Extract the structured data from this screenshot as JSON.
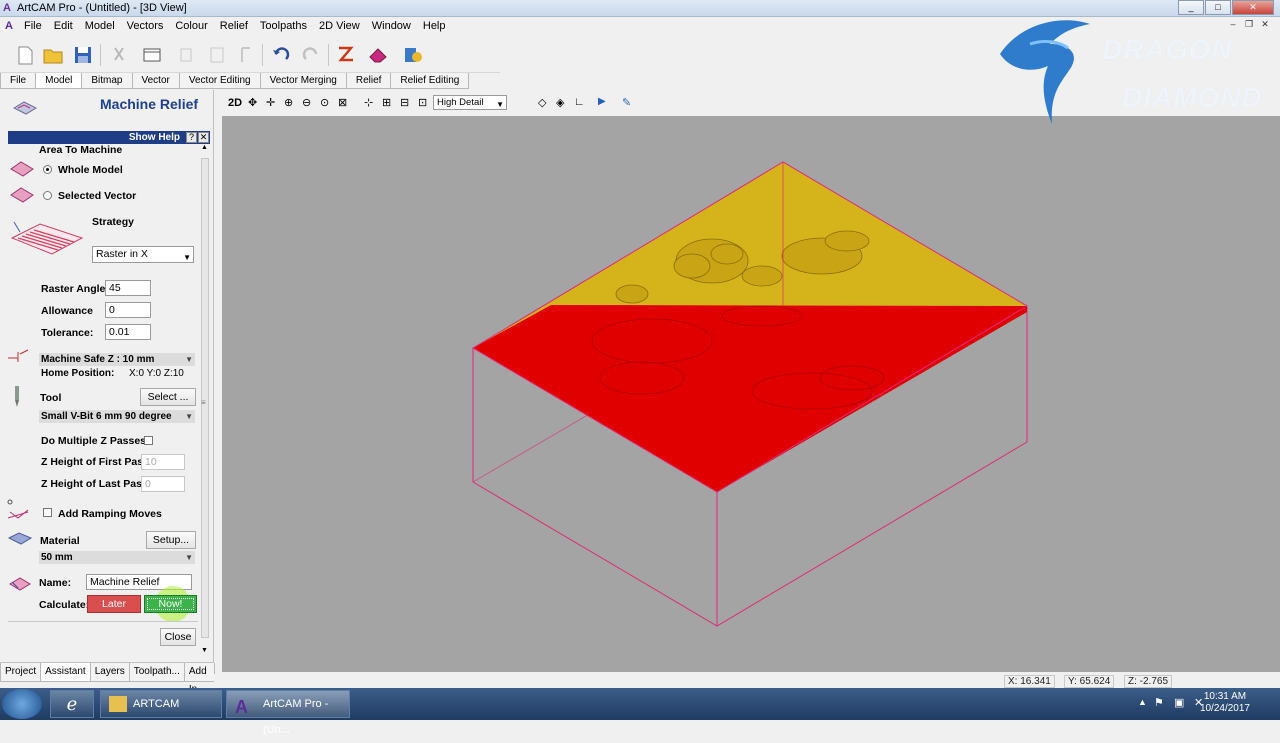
{
  "window": {
    "title": "ArtCAM Pro - (Untitled) - [3D View]",
    "controls": [
      "_",
      "□",
      "✕"
    ]
  },
  "menu": [
    "File",
    "Edit",
    "Model",
    "Vectors",
    "Colour",
    "Relief",
    "Toolpaths",
    "2D View",
    "Window",
    "Help"
  ],
  "toolbar_tabs": [
    "File",
    "Model",
    "Bitmap",
    "Vector",
    "Vector Editing",
    "Vector Merging",
    "Relief",
    "Relief Editing"
  ],
  "logo": {
    "line1": "DRAGON",
    "line2": "DIAMOND"
  },
  "panel": {
    "title": "Machine Relief",
    "show_help": "Show Help",
    "help_q": "?",
    "help_x": "✕",
    "area_heading": "Area To Machine",
    "whole_model": "Whole Model",
    "selected_vector": "Selected Vector",
    "strategy_heading": "Strategy",
    "strategy_value": "Raster in X",
    "raster_angle_label": "Raster Angle:",
    "raster_angle_value": "45",
    "allowance_label": "Allowance",
    "allowance_value": "0",
    "tolerance_label": "Tolerance:",
    "tolerance_value": "0.01",
    "safe_z": "Machine Safe Z : 10 mm",
    "home_label": "Home Position:",
    "home_value": "X:0 Y:0 Z:10",
    "tool_label": "Tool",
    "tool_select": "Select ...",
    "tool_value": "Small V-Bit 6 mm 90 degree",
    "multi_z_label": "Do Multiple Z Passes",
    "z_first_label": "Z Height of First Pass",
    "z_first_value": "10",
    "z_last_label": "Z Height of Last Pass",
    "z_last_value": "0",
    "ramping_label": "Add Ramping Moves",
    "material_label": "Material",
    "material_setup": "Setup...",
    "material_value": "50 mm",
    "name_label": "Name:",
    "name_value": "Machine Relief",
    "calculate_label": "Calculate:",
    "later_label": "Later",
    "now_label": "Now!",
    "close_label": "Close"
  },
  "bottom_tabs": [
    "Project",
    "Assistant",
    "Layers",
    "Toolpath...",
    "Add In"
  ],
  "view_toolbar": {
    "mode_2d": "2D",
    "detail": "High Detail"
  },
  "status": {
    "x": "X: 16.341",
    "y": "Y: 65.624",
    "z": "Z: -2.765"
  },
  "taskbar": {
    "item1": "ARTCAM",
    "item2": "ArtCAM Pro - (Un...",
    "time": "10:31 AM",
    "date": "10/24/2017"
  },
  "colors": {
    "relief_top": "#d4b41a",
    "relief_machined": "#e00000",
    "bbox": "#e0287a",
    "viewport_bg": "#a4a4a4"
  }
}
